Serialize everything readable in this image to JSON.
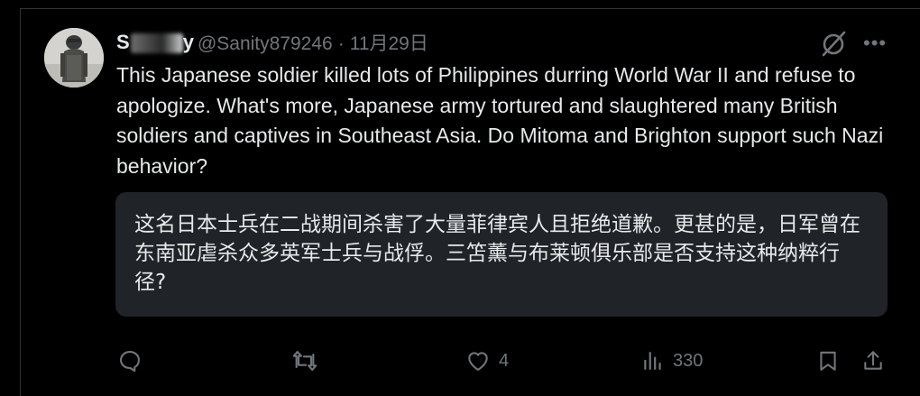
{
  "tweet": {
    "display_name_visible": "S",
    "display_name_end": "y",
    "handle": "@Sanity879246",
    "separator": "·",
    "date": "11月29日",
    "text": "This Japanese soldier killed lots of Philippines durring World War II and refuse to apologize. What's more, Japanese army tortured and slaughtered many British soldiers and captives in Southeast Asia. Do Mitoma and Brighton support such Nazi behavior?",
    "translation": "这名日本士兵在二战期间杀害了大量菲律宾人且拒绝道歉。更甚的是，日军曾在东南亚虐杀众多英军士兵与战俘。三笘薰与布莱顿俱乐部是否支持这种纳粹行径?"
  },
  "header_icons": {
    "grok": "grok-slash-icon",
    "more": "•••"
  },
  "actions": {
    "reply": {
      "icon": "reply-icon",
      "count": ""
    },
    "repost": {
      "icon": "repost-icon",
      "count": ""
    },
    "like": {
      "icon": "heart-icon",
      "count": "4"
    },
    "views": {
      "icon": "views-bar-icon",
      "count": "330"
    },
    "bookmark": {
      "icon": "bookmark-icon"
    },
    "share": {
      "icon": "share-icon"
    }
  },
  "colors": {
    "background": "#000000",
    "text_primary": "#e7e9ea",
    "text_secondary": "#71767b",
    "translation_bg": "#202327",
    "border": "#2f3336"
  }
}
